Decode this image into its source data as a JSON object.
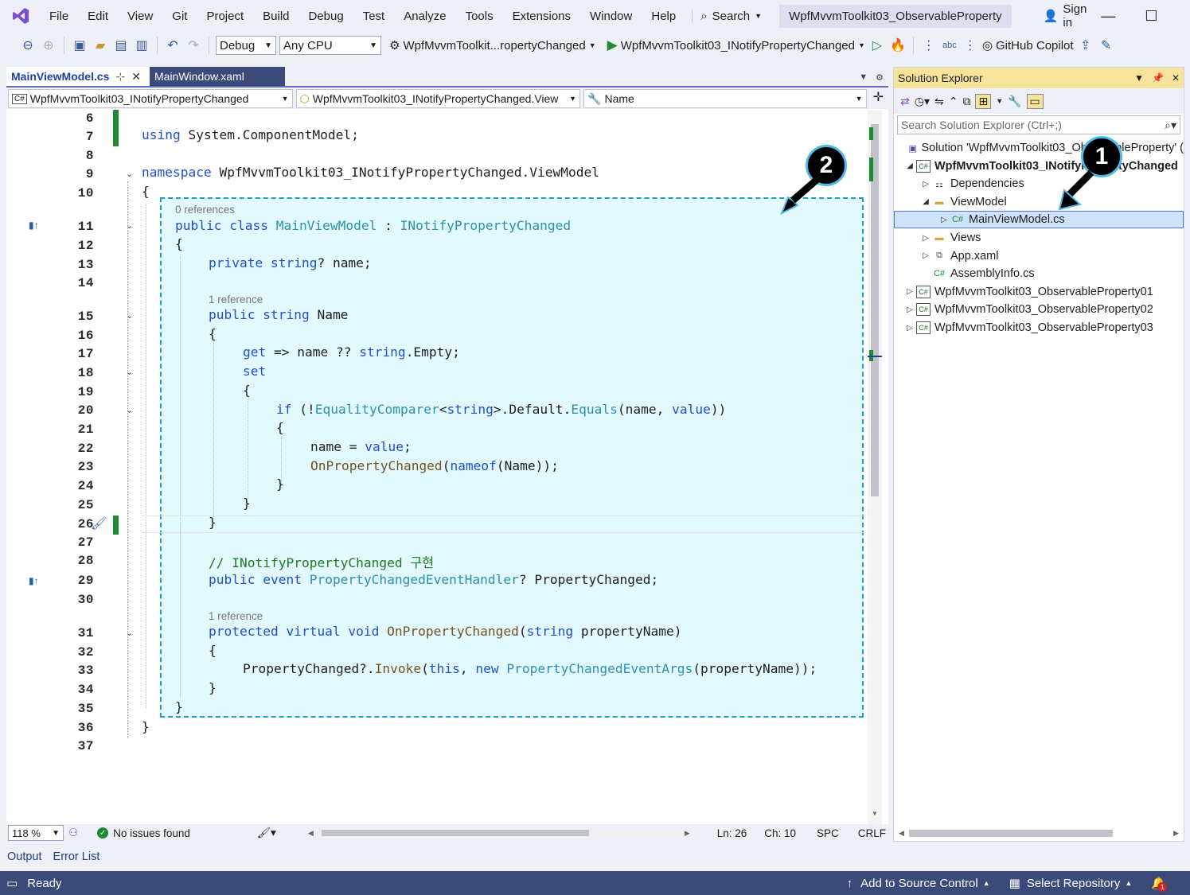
{
  "menu": {
    "items": [
      "File",
      "Edit",
      "View",
      "Git",
      "Project",
      "Build",
      "Debug",
      "Test",
      "Analyze",
      "Tools",
      "Extensions",
      "Window",
      "Help"
    ],
    "search_label": "Search",
    "solution_title": "WpfMvvmToolkit03_ObservableProperty",
    "sign_in": "Sign in"
  },
  "toolbar": {
    "config": "Debug",
    "platform": "Any CPU",
    "startup_project": "WpfMvvmToolkit...ropertyChanged",
    "run_target": "WpfMvvmToolkit03_INotifyPropertyChanged",
    "copilot": "GitHub Copilot"
  },
  "tabs": [
    {
      "label": "MainViewModel.cs",
      "active": true
    },
    {
      "label": "MainWindow.xaml",
      "active": false
    }
  ],
  "navbar": {
    "project": "WpfMvvmToolkit03_INotifyPropertyChanged",
    "type": "WpfMvvmToolkit03_INotifyPropertyChanged.View",
    "member": "Name"
  },
  "editor": {
    "line_numbers": [
      "6",
      "7",
      "8",
      "9",
      "10",
      "11",
      "12",
      "13",
      "14",
      "15",
      "16",
      "17",
      "18",
      "19",
      "20",
      "21",
      "22",
      "23",
      "24",
      "25",
      "26",
      "27",
      "28",
      "29",
      "30",
      "31",
      "32",
      "33",
      "34",
      "35",
      "36",
      "37"
    ],
    "lens_class": "0 references",
    "lens_name": "1 reference",
    "lens_method": "1 reference",
    "comment_text": "// INotifyPropertyChanged 구현"
  },
  "editor_status": {
    "zoom": "118 %",
    "issues": "No issues found",
    "line": "Ln: 26",
    "col": "Ch: 10",
    "indent": "SPC",
    "eol": "CRLF"
  },
  "solution_explorer": {
    "title": "Solution Explorer",
    "search_placeholder": "Search Solution Explorer (Ctrl+;)",
    "tree": [
      {
        "label": "Solution 'WpfMvvmToolkit03_ObservableProperty' (",
        "icon": "solution-icon"
      },
      {
        "label": "WpfMvvmToolkit03_INotifyPropertyChanged",
        "icon": "csproj-icon"
      },
      {
        "label": "Dependencies",
        "icon": "dependencies-icon"
      },
      {
        "label": "ViewModel",
        "icon": "folder-icon"
      },
      {
        "label": "MainViewModel.cs",
        "icon": "csharp-file-icon",
        "selected": true
      },
      {
        "label": "Views",
        "icon": "folder-icon"
      },
      {
        "label": "App.xaml",
        "icon": "xaml-file-icon"
      },
      {
        "label": "AssemblyInfo.cs",
        "icon": "csharp-file-icon"
      },
      {
        "label": "WpfMvvmToolkit03_ObservableProperty01",
        "icon": "csproj-icon"
      },
      {
        "label": "WpfMvvmToolkit03_ObservableProperty02",
        "icon": "csproj-icon"
      },
      {
        "label": "WpfMvvmToolkit03_ObservableProperty03",
        "icon": "csproj-icon"
      }
    ]
  },
  "bottom_tabs": [
    "Output",
    "Error List"
  ],
  "statusbar": {
    "ready": "Ready",
    "source_control": "Add to Source Control",
    "repository": "Select Repository",
    "notifications": "1"
  },
  "annotations": {
    "badge1": "1",
    "badge2": "2"
  },
  "colors": {
    "accent": "#3c4a7a",
    "highlight": "#e2fafd",
    "keyword": "#1f4fd0",
    "type": "#2b91af"
  }
}
